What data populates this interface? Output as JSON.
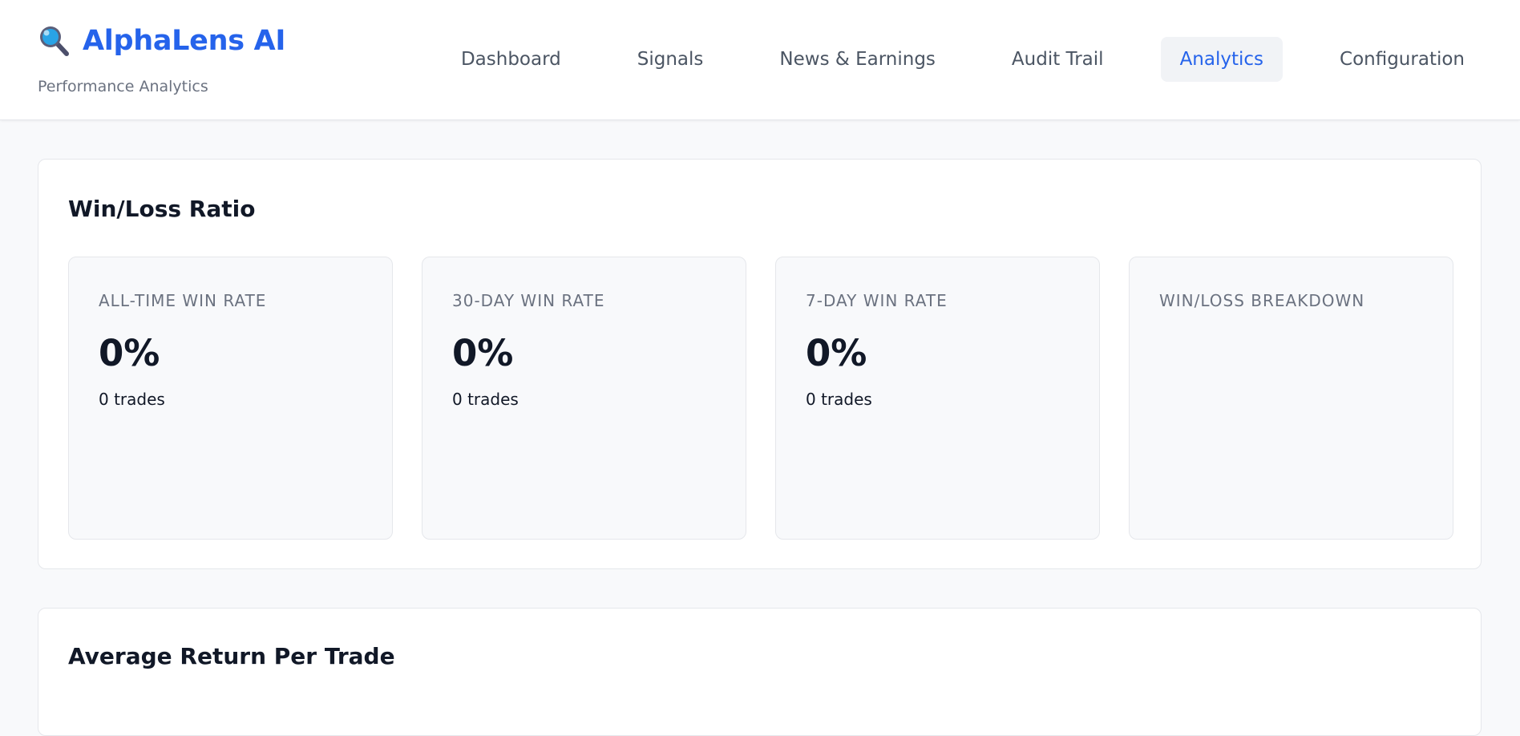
{
  "brand": {
    "icon": "magnifying-glass-icon",
    "title": "AlphaLens AI",
    "subtitle": "Performance Analytics",
    "color": "#2563eb"
  },
  "nav": {
    "items": [
      {
        "label": "Dashboard",
        "active": false
      },
      {
        "label": "Signals",
        "active": false
      },
      {
        "label": "News & Earnings",
        "active": false
      },
      {
        "label": "Audit Trail",
        "active": false
      },
      {
        "label": "Analytics",
        "active": true
      },
      {
        "label": "Configuration",
        "active": false
      }
    ]
  },
  "win_loss": {
    "title": "Win/Loss Ratio",
    "cards": [
      {
        "label": "ALL-TIME WIN RATE",
        "value": "0%",
        "sub": "0 trades"
      },
      {
        "label": "30-DAY WIN RATE",
        "value": "0%",
        "sub": "0 trades"
      },
      {
        "label": "7-DAY WIN RATE",
        "value": "0%",
        "sub": "0 trades"
      },
      {
        "label": "WIN/LOSS BREAKDOWN",
        "value": "",
        "sub": ""
      }
    ]
  },
  "avg_return": {
    "title": "Average Return Per Trade"
  }
}
